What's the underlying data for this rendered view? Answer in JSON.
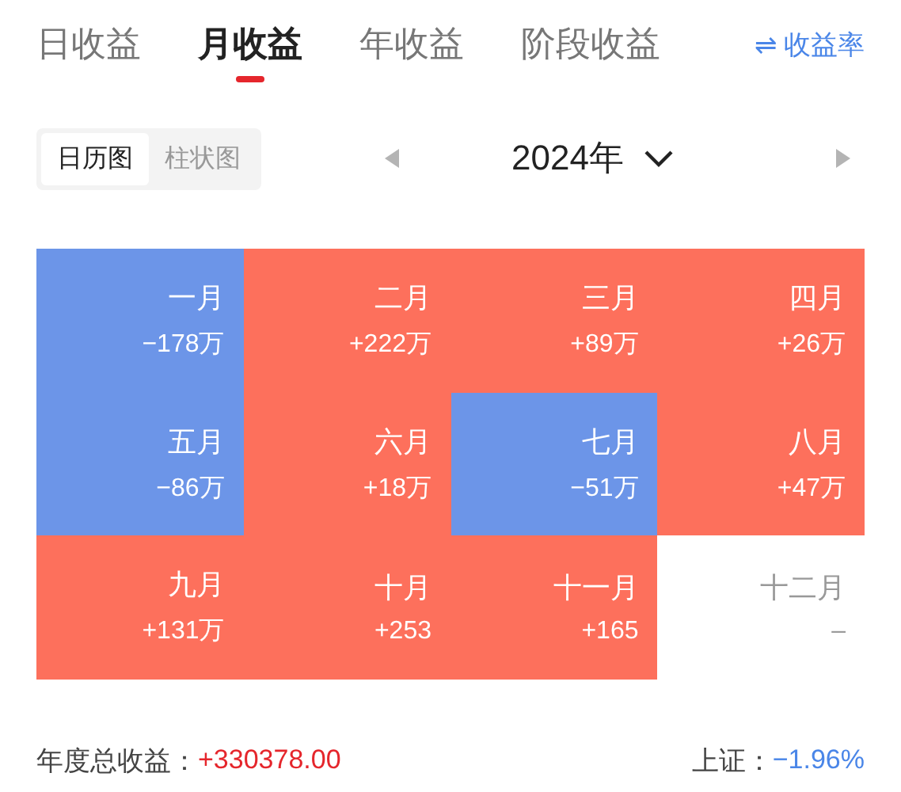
{
  "tabs": [
    {
      "label": "日收益",
      "selected": false
    },
    {
      "label": "月收益",
      "selected": true
    },
    {
      "label": "年收益",
      "selected": false
    },
    {
      "label": "阶段收益",
      "selected": false
    }
  ],
  "rate_toggle": {
    "icon": "⇌",
    "label": "收益率"
  },
  "view_switch": [
    {
      "label": "日历图",
      "selected": true
    },
    {
      "label": "柱状图",
      "selected": false
    }
  ],
  "year_picker": {
    "label": "2024年"
  },
  "months": [
    {
      "name": "一月",
      "value": "−178万",
      "color": "#6c95e8"
    },
    {
      "name": "二月",
      "value": "+222万",
      "color": "#fd705c"
    },
    {
      "name": "三月",
      "value": "+89万",
      "color": "#fd705c"
    },
    {
      "name": "四月",
      "value": "+26万",
      "color": "#fd705c"
    },
    {
      "name": "五月",
      "value": "−86万",
      "color": "#6c95e8"
    },
    {
      "name": "六月",
      "value": "+18万",
      "color": "#fd705c"
    },
    {
      "name": "七月",
      "value": "−51万",
      "color": "#6c95e8"
    },
    {
      "name": "八月",
      "value": "+47万",
      "color": "#fd705c"
    },
    {
      "name": "九月",
      "value": "+131万",
      "color": "#fd705c"
    },
    {
      "name": "十月",
      "value": "+253",
      "color": "#fd705c"
    },
    {
      "name": "十一月",
      "value": "+165",
      "color": "#fd705c"
    },
    {
      "name": "十二月",
      "value": "–",
      "color": "#ffffff"
    }
  ],
  "summary": {
    "total_label": "年度总收益：",
    "total_value": "+330378.00",
    "index_label": "上证：",
    "index_value": "−1.96%"
  }
}
